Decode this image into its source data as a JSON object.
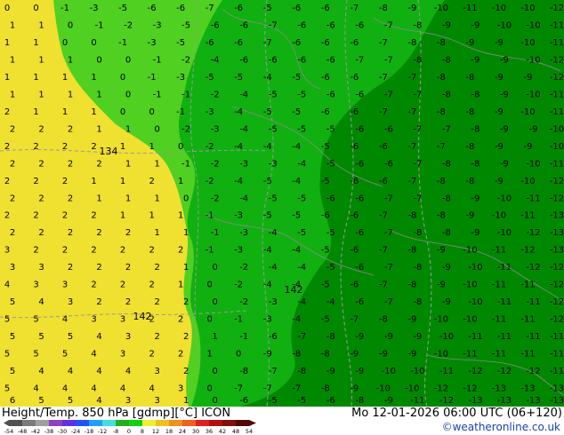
{
  "title": "Height/Temp. 850 hPa [gdmp][°C] ICON",
  "valid_time": "Mo 12-01-2026 06:00 UTC (06+120)",
  "credit": "©weatheronline.co.uk",
  "colors": {
    "yellow": "#f0e030",
    "lightgreen": "#50d020",
    "green": "#10b010",
    "darkgreen": "#008800",
    "contour": "#9a9a9a"
  },
  "colorbar": {
    "ticks": [
      "-54",
      "-48",
      "-42",
      "-38",
      "-30",
      "-24",
      "-18",
      "-12",
      "-8",
      "0",
      "8",
      "12",
      "18",
      "24",
      "30",
      "36",
      "42",
      "48",
      "54"
    ],
    "colors": [
      "#505050",
      "#7a7a7a",
      "#a0a0a0",
      "#9040c0",
      "#6030e0",
      "#2050ff",
      "#20a0ff",
      "#40e0e0",
      "#20b020",
      "#10d010",
      "#f0f030",
      "#f0c020",
      "#f09020",
      "#f06020",
      "#e02020",
      "#b01010",
      "#801010",
      "#500808"
    ]
  },
  "height_labels": [
    "134",
    "142",
    "142"
  ],
  "temp_labels": [
    [
      "0",
      "0",
      "-1",
      "-3",
      "-5",
      "-6",
      "-6",
      "-7",
      "-6",
      "-5",
      "-6",
      "-6",
      "-7",
      "-8",
      "-9",
      "-10",
      "-11",
      "-10",
      "-10",
      "-12"
    ],
    [
      "1",
      "1",
      "0",
      "-1",
      "-2",
      "-3",
      "-5",
      "-6",
      "-6",
      "-7",
      "-6",
      "-6",
      "-6",
      "-7",
      "-8",
      "-9",
      "-9",
      "-10",
      "-10",
      "-11"
    ],
    [
      "1",
      "1",
      "0",
      "0",
      "-1",
      "-3",
      "-5",
      "-6",
      "-6",
      "-7",
      "-6",
      "-6",
      "-6",
      "-7",
      "-8",
      "-8",
      "-9",
      "-9",
      "-10",
      "-11"
    ],
    [
      "1",
      "1",
      "1",
      "0",
      "0",
      "-1",
      "-2",
      "-4",
      "-6",
      "-6",
      "-6",
      "-6",
      "-7",
      "-7",
      "-8",
      "-8",
      "-9",
      "-9",
      "-10",
      "-12"
    ],
    [
      "1",
      "1",
      "1",
      "1",
      "0",
      "-1",
      "-3",
      "-5",
      "-5",
      "-4",
      "-5",
      "-6",
      "-6",
      "-7",
      "-7",
      "-8",
      "-8",
      "-9",
      "-9",
      "-12"
    ],
    [
      "1",
      "1",
      "1",
      "1",
      "0",
      "-1",
      "-1",
      "-2",
      "-4",
      "-5",
      "-5",
      "-6",
      "-6",
      "-7",
      "-7",
      "-8",
      "-8",
      "-9",
      "-10",
      "-11"
    ],
    [
      "2",
      "1",
      "1",
      "1",
      "0",
      "0",
      "-1",
      "-3",
      "-4",
      "-5",
      "-5",
      "-6",
      "-6",
      "-7",
      "-7",
      "-8",
      "-8",
      "-9",
      "-10",
      "-11"
    ],
    [
      "2",
      "2",
      "2",
      "1",
      "1",
      "0",
      "-2",
      "-3",
      "-4",
      "-5",
      "-5",
      "-5",
      "-6",
      "-6",
      "-7",
      "-7",
      "-8",
      "-9",
      "-9",
      "-10"
    ],
    [
      "2",
      "2",
      "2",
      "2",
      "1",
      "1",
      "0",
      "-2",
      "-4",
      "-4",
      "-4",
      "-5",
      "-6",
      "-6",
      "-7",
      "-7",
      "-8",
      "-9",
      "-9",
      "-10"
    ],
    [
      "2",
      "2",
      "2",
      "2",
      "1",
      "1",
      "-1",
      "-2",
      "-3",
      "-3",
      "-4",
      "-5",
      "-6",
      "-6",
      "-7",
      "-8",
      "-8",
      "-9",
      "-10",
      "-11"
    ],
    [
      "2",
      "2",
      "2",
      "1",
      "1",
      "2",
      "1",
      "-2",
      "-4",
      "-5",
      "-4",
      "-5",
      "-6",
      "-6",
      "-7",
      "-8",
      "-8",
      "-9",
      "-10",
      "-12"
    ],
    [
      "2",
      "2",
      "2",
      "1",
      "1",
      "1",
      "0",
      "-2",
      "-4",
      "-5",
      "-5",
      "-6",
      "-6",
      "-7",
      "-7",
      "-8",
      "-9",
      "-10",
      "-11",
      "-12"
    ],
    [
      "2",
      "2",
      "2",
      "2",
      "1",
      "1",
      "1",
      "-1",
      "-3",
      "-5",
      "-5",
      "-6",
      "-6",
      "-7",
      "-8",
      "-8",
      "-9",
      "-10",
      "-11",
      "-13"
    ],
    [
      "2",
      "2",
      "2",
      "2",
      "2",
      "1",
      "1",
      "-1",
      "-3",
      "-4",
      "-5",
      "-5",
      "-6",
      "-7",
      "-8",
      "-8",
      "-9",
      "-10",
      "-12",
      "-13"
    ],
    [
      "3",
      "2",
      "2",
      "2",
      "2",
      "2",
      "2",
      "-1",
      "-3",
      "-4",
      "-4",
      "-5",
      "-6",
      "-7",
      "-8",
      "-9",
      "-10",
      "-11",
      "-12",
      "-13"
    ],
    [
      "3",
      "3",
      "2",
      "2",
      "2",
      "2",
      "1",
      "0",
      "-2",
      "-4",
      "-4",
      "-5",
      "-6",
      "-7",
      "-8",
      "-9",
      "-10",
      "-11",
      "-12",
      "-12"
    ],
    [
      "4",
      "3",
      "3",
      "2",
      "2",
      "2",
      "1",
      "0",
      "-2",
      "-4",
      "-4",
      "-5",
      "-6",
      "-7",
      "-8",
      "-9",
      "-10",
      "-11",
      "-11",
      "-12"
    ],
    [
      "5",
      "4",
      "3",
      "2",
      "2",
      "2",
      "2",
      "0",
      "-2",
      "-3",
      "-4",
      "-4",
      "-6",
      "-7",
      "-8",
      "-9",
      "-10",
      "-11",
      "-11",
      "-12"
    ],
    [
      "5",
      "5",
      "4",
      "3",
      "3",
      "2",
      "2",
      "0",
      "-1",
      "-3",
      "-4",
      "-5",
      "-7",
      "-8",
      "-9",
      "-10",
      "-10",
      "-11",
      "-11",
      "-12"
    ],
    [
      "5",
      "5",
      "5",
      "4",
      "3",
      "2",
      "2",
      "1",
      "-1",
      "-6",
      "-7",
      "-8",
      "-9",
      "-9",
      "-9",
      "-10",
      "-11",
      "-11",
      "-11",
      "-11"
    ],
    [
      "5",
      "5",
      "5",
      "4",
      "3",
      "2",
      "2",
      "1",
      "0",
      "-9",
      "-8",
      "-8",
      "-9",
      "-9",
      "-9",
      "-10",
      "-11",
      "-11",
      "-11",
      "-11"
    ],
    [
      "5",
      "4",
      "4",
      "4",
      "4",
      "3",
      "2",
      "0",
      "-8",
      "-7",
      "-8",
      "-9",
      "-9",
      "-10",
      "-10",
      "-11",
      "-12",
      "-12",
      "-12",
      "-11"
    ],
    [
      "5",
      "4",
      "4",
      "4",
      "4",
      "4",
      "3",
      "0",
      "-7",
      "-7",
      "-7",
      "-8",
      "-9",
      "-10",
      "-10",
      "-12",
      "-12",
      "-13",
      "-13",
      "-13"
    ],
    [
      "6",
      "5",
      "5",
      "4",
      "3",
      "3",
      "1",
      "0",
      "-6",
      "-5",
      "-5",
      "-6",
      "-8",
      "-9",
      "-11",
      "-12",
      "-13",
      "-13",
      "-13",
      "-13"
    ]
  ]
}
